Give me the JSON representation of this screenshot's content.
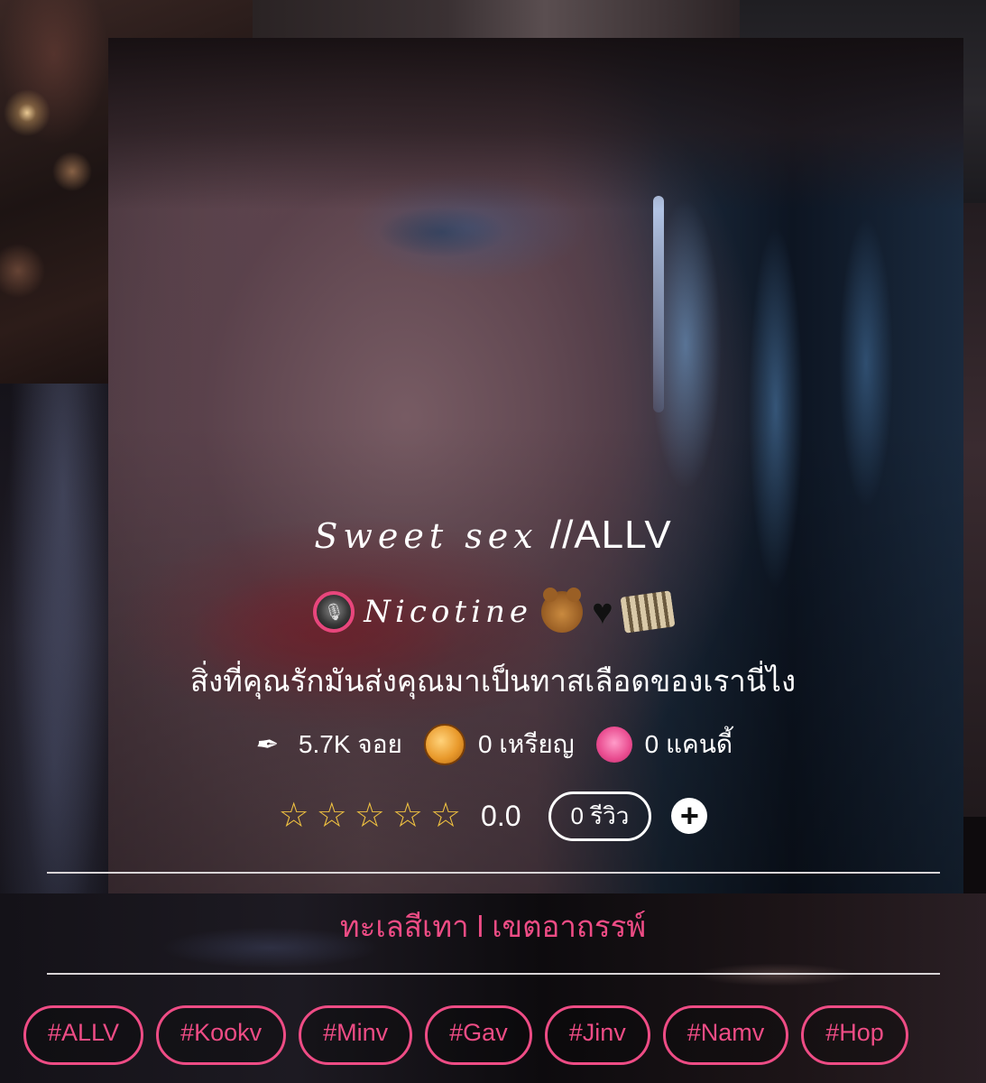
{
  "title": {
    "script": "Sweet sex",
    "suffix": "//ALLV"
  },
  "author": {
    "name": "Nicotine",
    "icons": [
      "teddy-bear-icon",
      "black-heart-icon",
      "film-strip-icon"
    ]
  },
  "tagline": "สิ่งที่คุณรักมันส่งคุณมาเป็นทาสเลือดของเรานี่ไง",
  "stats": {
    "joy": "5.7K จอย",
    "coins": "0 เหรียญ",
    "candy": "0 แคนดี้"
  },
  "rating": {
    "stars_filled": 0,
    "stars_total": 5,
    "score": "0.0",
    "reviews_label": "0 รีวิว",
    "add_label": "+"
  },
  "genre": "ทะเลสีเทา l เขตอาถรรพ์",
  "tags": [
    "#ALLV",
    "#Kookv",
    "#Minv",
    "#Gav",
    "#Jinv",
    "#Namv",
    "#Hop"
  ],
  "colors": {
    "accent": "#ee4c85",
    "star": "#f0c240",
    "text": "#ffffff"
  }
}
